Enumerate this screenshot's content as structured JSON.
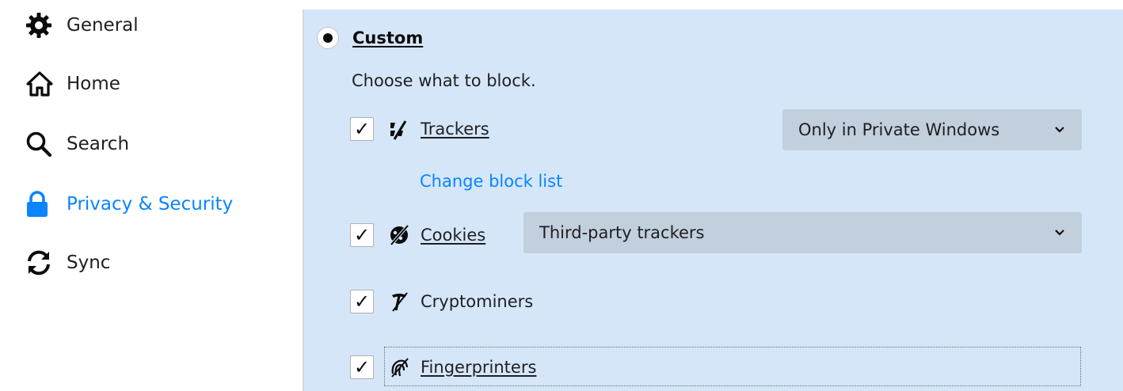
{
  "sidebar": {
    "items": [
      {
        "label": "General",
        "icon": "gear-icon"
      },
      {
        "label": "Home",
        "icon": "home-icon"
      },
      {
        "label": "Search",
        "icon": "search-icon"
      },
      {
        "label": "Privacy & Security",
        "icon": "lock-icon",
        "selected": true
      },
      {
        "label": "Sync",
        "icon": "sync-icon"
      }
    ]
  },
  "content": {
    "custom_label": "Custom",
    "description": "Choose what to block.",
    "trackers": {
      "label": "Trackers",
      "checked": true,
      "icon": "trackers-icon",
      "select_value": "Only in Private Windows",
      "link": "Change block list"
    },
    "cookies": {
      "label": "Cookies",
      "checked": true,
      "icon": "cookies-icon",
      "select_value": "Third-party trackers"
    },
    "cryptominers": {
      "label": "Cryptominers",
      "checked": true,
      "icon": "cryptominers-icon"
    },
    "fingerprinters": {
      "label": "Fingerprinters",
      "checked": true,
      "icon": "fingerprinters-icon"
    }
  },
  "colors": {
    "accent": "#0a84ff",
    "panel_bg": "#d5e6f9",
    "select_bg": "#c2cfdd"
  }
}
